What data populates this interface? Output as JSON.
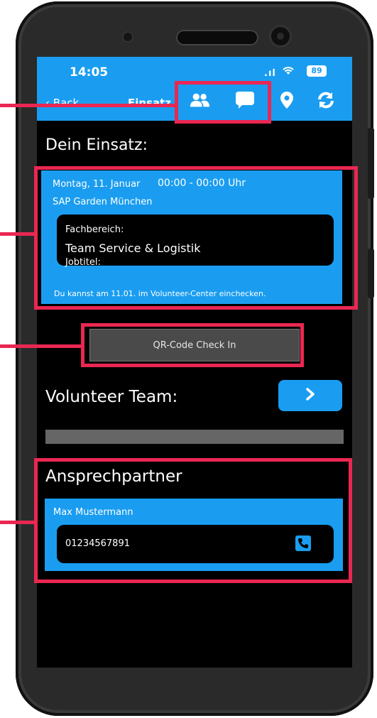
{
  "status": {
    "time": "14:05",
    "signal": ".ıl",
    "battery": "89"
  },
  "nav": {
    "back_label": "Back",
    "title": "Einsatz",
    "icons": [
      "people-icon",
      "chat-icon",
      "location-pin-icon",
      "refresh-icon"
    ]
  },
  "assignment": {
    "heading": "Dein Einsatz:",
    "date": "Montag, 11. Januar",
    "time_range": "00:00 - 00:00 Uhr",
    "venue": "SAP Garden München",
    "field_label": "Fachbereich:",
    "field_value": "Team Service & Logistik",
    "job_label": "Jobtitel:",
    "checkin_note": "Du kannst am 11.01. im Volunteer-Center einchecken."
  },
  "qr_button": {
    "label": "QR-Code Check In"
  },
  "team": {
    "heading": "Volunteer Team:"
  },
  "contact": {
    "heading": "Ansprechpartner",
    "name": "Max Mustermann",
    "phone": "01234567891"
  },
  "colors": {
    "accent": "#1a9df0",
    "annotation": "#ea2752",
    "background": "#000000"
  }
}
